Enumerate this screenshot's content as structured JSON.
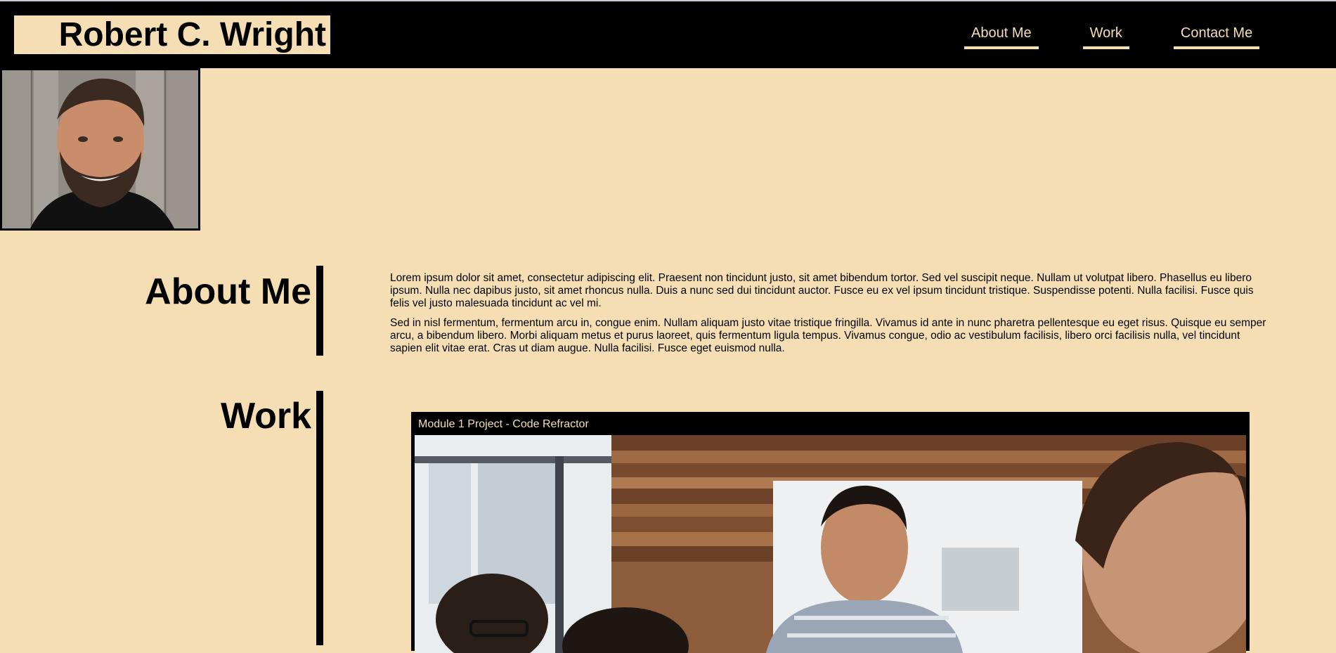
{
  "site": {
    "title": "Robert C. Wright"
  },
  "nav": {
    "items": [
      {
        "label": "About Me"
      },
      {
        "label": "Work"
      },
      {
        "label": "Contact Me"
      }
    ]
  },
  "about": {
    "heading": "About Me",
    "paragraphs": [
      "Lorem ipsum dolor sit amet, consectetur adipiscing elit. Praesent non tincidunt justo, sit amet bibendum tortor. Sed vel suscipit neque. Nullam ut volutpat libero. Phasellus eu libero ipsum. Nulla nec dapibus justo, sit amet rhoncus nulla. Duis a nunc sed dui tincidunt auctor. Fusce eu ex vel ipsum tincidunt tristique. Suspendisse potenti. Nulla facilisi. Fusce quis felis vel justo malesuada tincidunt ac vel mi.",
      "Sed in nisl fermentum, fermentum arcu in, congue enim. Nullam aliquam justo vitae tristique fringilla. Vivamus id ante in nunc pharetra pellentesque eu eget risus. Quisque eu semper arcu, a bibendum libero. Morbi aliquam metus et purus laoreet, quis fermentum ligula tempus. Vivamus congue, odio ac vestibulum facilisis, libero orci facilisis nulla, vel tincidunt sapien elit vitae erat. Cras ut diam augue. Nulla facilisi. Fusce eget euismod nulla."
    ]
  },
  "work": {
    "heading": "Work",
    "projects": [
      {
        "title": "Module 1 Project - Code Refractor"
      }
    ]
  },
  "colors": {
    "background": "#f5deb3",
    "header": "#000000",
    "accent": "#f5deb3"
  }
}
